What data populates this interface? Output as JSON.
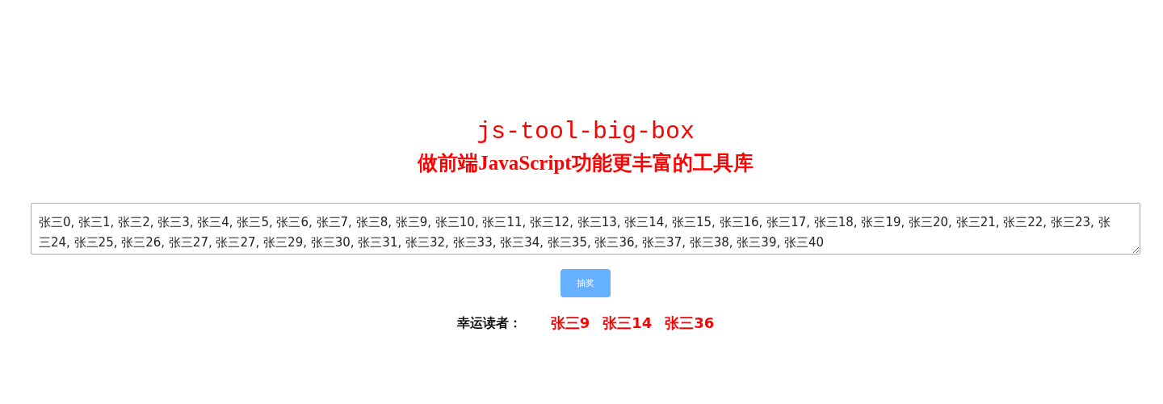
{
  "title": "js-tool-big-box",
  "subtitle": "做前端JavaScript功能更丰富的工具库",
  "names_field": {
    "value": "张三0, 张三1, 张三2, 张三3, 张三4, 张三5, 张三6, 张三7, 张三8, 张三9, 张三10, 张三11, 张三12, 张三13, 张三14, 张三15, 张三16, 张三17, 张三18, 张三19, 张三20, 张三21, 张三22, 张三23, 张三24, 张三25, 张三26, 张三27, 张三27, 张三29, 张三30, 张三31, 张三32, 张三33, 张三34, 张三35, 张三36, 张三37, 张三38, 张三39, 张三40"
  },
  "draw_button": "抽奖",
  "winners": {
    "label": "幸运读者：",
    "names": [
      "张三9",
      "张三14",
      "张三36"
    ]
  }
}
